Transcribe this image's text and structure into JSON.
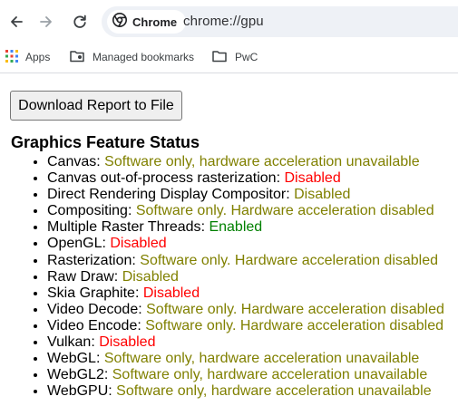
{
  "browser": {
    "chip_label": "Chrome",
    "url": "chrome://gpu",
    "icons": {
      "back": "back-arrow-icon",
      "forward": "forward-arrow-icon",
      "reload": "reload-icon",
      "site": "chrome-logo-icon"
    },
    "bookmarks": [
      {
        "label": "Apps",
        "icon": "apps-grid-icon"
      },
      {
        "label": "Managed bookmarks",
        "icon": "managed-folder-icon"
      },
      {
        "label": "PwC",
        "icon": "folder-icon"
      }
    ]
  },
  "page": {
    "download_button_label": "Download Report to File",
    "section_title": "Graphics Feature Status",
    "features": [
      {
        "name": "Canvas",
        "status": "Software only, hardware acceleration unavailable",
        "color": "#808000"
      },
      {
        "name": "Canvas out-of-process rasterization",
        "status": "Disabled",
        "color": "#ff0000"
      },
      {
        "name": "Direct Rendering Display Compositor",
        "status": "Disabled",
        "color": "#808000"
      },
      {
        "name": "Compositing",
        "status": "Software only. Hardware acceleration disabled",
        "color": "#808000"
      },
      {
        "name": "Multiple Raster Threads",
        "status": "Enabled",
        "color": "#008000"
      },
      {
        "name": "OpenGL",
        "status": "Disabled",
        "color": "#ff0000"
      },
      {
        "name": "Rasterization",
        "status": "Software only. Hardware acceleration disabled",
        "color": "#808000"
      },
      {
        "name": "Raw Draw",
        "status": "Disabled",
        "color": "#808000"
      },
      {
        "name": "Skia Graphite",
        "status": "Disabled",
        "color": "#ff0000"
      },
      {
        "name": "Video Decode",
        "status": "Software only. Hardware acceleration disabled",
        "color": "#808000"
      },
      {
        "name": "Video Encode",
        "status": "Software only. Hardware acceleration disabled",
        "color": "#808000"
      },
      {
        "name": "Vulkan",
        "status": "Disabled",
        "color": "#ff0000"
      },
      {
        "name": "WebGL",
        "status": "Software only, hardware acceleration unavailable",
        "color": "#808000"
      },
      {
        "name": "WebGL2",
        "status": "Software only, hardware acceleration unavailable",
        "color": "#808000"
      },
      {
        "name": "WebGPU",
        "status": "Software only, hardware acceleration unavailable",
        "color": "#808000"
      }
    ]
  }
}
